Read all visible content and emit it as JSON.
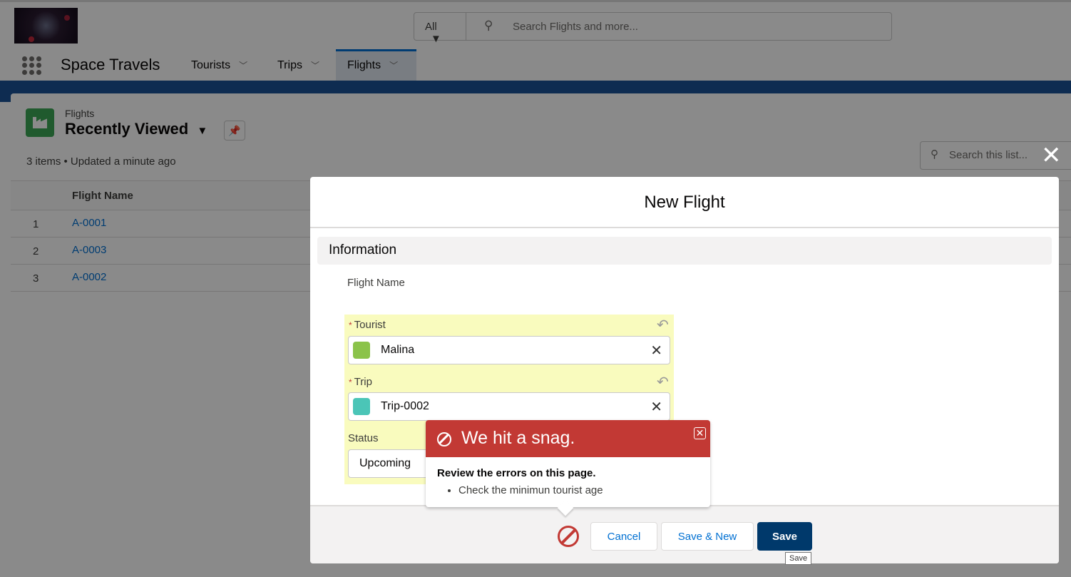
{
  "global_search": {
    "scope": "All",
    "placeholder": "Search Flights and more..."
  },
  "app_name": "Space Travels",
  "nav_tabs": [
    {
      "label": "Tourists"
    },
    {
      "label": "Trips"
    },
    {
      "label": "Flights",
      "active": true
    }
  ],
  "list_view": {
    "object": "Flights",
    "title": "Recently Viewed",
    "meta": "3 items • Updated a minute ago",
    "search_placeholder": "Search this list...",
    "column": "Flight Name",
    "rows": [
      {
        "num": "1",
        "name": "A-0001"
      },
      {
        "num": "2",
        "name": "A-0003"
      },
      {
        "num": "3",
        "name": "A-0002"
      }
    ]
  },
  "modal": {
    "title": "New Flight",
    "section": "Information",
    "flight_name_label": "Flight Name",
    "tourist_label": "Tourist",
    "tourist_value": "Malina",
    "trip_label": "Trip",
    "trip_value": "Trip-0002",
    "status_label": "Status",
    "status_value": "Upcoming",
    "cancel": "Cancel",
    "save_new": "Save & New",
    "save": "Save",
    "save_tooltip": "Save"
  },
  "error_popover": {
    "title": "We hit a snag.",
    "heading": "Review the errors on this page.",
    "errors": [
      "Check the minimun tourist age"
    ]
  },
  "colors": {
    "brand": "#0070d2",
    "error": "#c23934",
    "save": "#00396b",
    "highlight": "#f9fbbe"
  }
}
